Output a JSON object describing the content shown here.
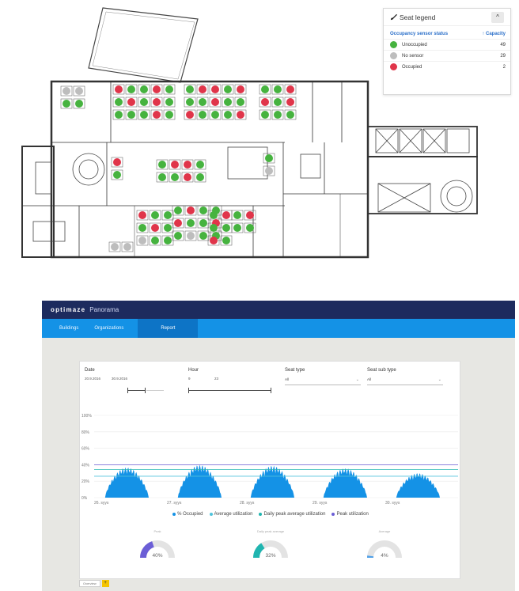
{
  "legend": {
    "title": "Seat legend",
    "icon": "brush-icon",
    "collapse_icon": "chevron-up-icon",
    "col_status": "Occupancy sensor status",
    "col_capacity": "Capacity",
    "sort_icon": "sort-up-icon",
    "rows": [
      {
        "label": "Unoccupied",
        "count": "49",
        "color": "#46b33f"
      },
      {
        "label": "No sensor",
        "count": "29",
        "color": "#bdbdbd"
      },
      {
        "label": "Occupied",
        "count": "2",
        "color": "#e0354a"
      }
    ]
  },
  "app": {
    "logo": "optimaze",
    "product": "Panorama",
    "nav": [
      "Buildings",
      "Organizations",
      "Report"
    ],
    "active_nav": "Report"
  },
  "filters": {
    "date_label": "Date",
    "date_from": "20.9.2016",
    "date_to": "30.9.2016",
    "hour_label": "Hour",
    "hour_from": "9",
    "hour_to": "23",
    "seat_type_label": "Seat type",
    "seat_type_value": "All",
    "seat_subtype_label": "Seat sub type",
    "seat_subtype_value": "All"
  },
  "chart_data": {
    "type": "area",
    "title": "",
    "y_ticks": [
      "100%",
      "80%",
      "60%",
      "40%",
      "20%",
      "0%"
    ],
    "ylim": [
      0,
      100
    ],
    "x_ticks": [
      "26. syys",
      "27. syys",
      "28. syys",
      "29. syys",
      "30. syys"
    ],
    "series": [
      {
        "name": "% Occupied",
        "color": "#1492e6",
        "daily_peaks": [
          37,
          40,
          39,
          36,
          30
        ]
      },
      {
        "name": "Average utilization",
        "color": "#4fc3dc",
        "value": 26
      },
      {
        "name": "Daily peak average utilization",
        "color": "#20b5b0",
        "value": 34
      },
      {
        "name": "Peak utilization",
        "color": "#6b5ed6",
        "value": 40
      }
    ],
    "grid": true
  },
  "gauges": [
    {
      "title": "Peak",
      "value": 40,
      "label": "40%",
      "color": "#6b5ed6"
    },
    {
      "title": "Daily peak average",
      "value": 32,
      "label": "32%",
      "color": "#20b5b0"
    },
    {
      "title": "Average",
      "value": 4,
      "label": "4%",
      "color": "#4fa0e8"
    }
  ],
  "tabs": {
    "page": "Overview",
    "add": "+"
  }
}
